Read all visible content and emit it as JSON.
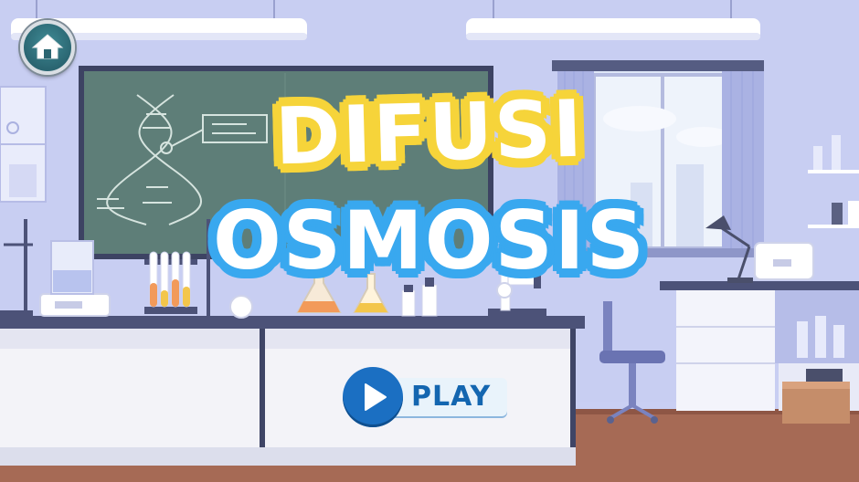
{
  "title": {
    "line1": "DIFUSI",
    "line2": "OSMOSIS"
  },
  "play_button": {
    "label": "PLAY"
  },
  "icons": {
    "home": "home-icon",
    "play": "play-icon"
  },
  "colors": {
    "background_wall": "#c9cff3",
    "title_line1_outline": "#f6d43a",
    "title_line2_outline": "#39a8ef",
    "play_accent": "#1b6fc2",
    "chalkboard": "#5e7e78",
    "floor": "#a66a55"
  }
}
